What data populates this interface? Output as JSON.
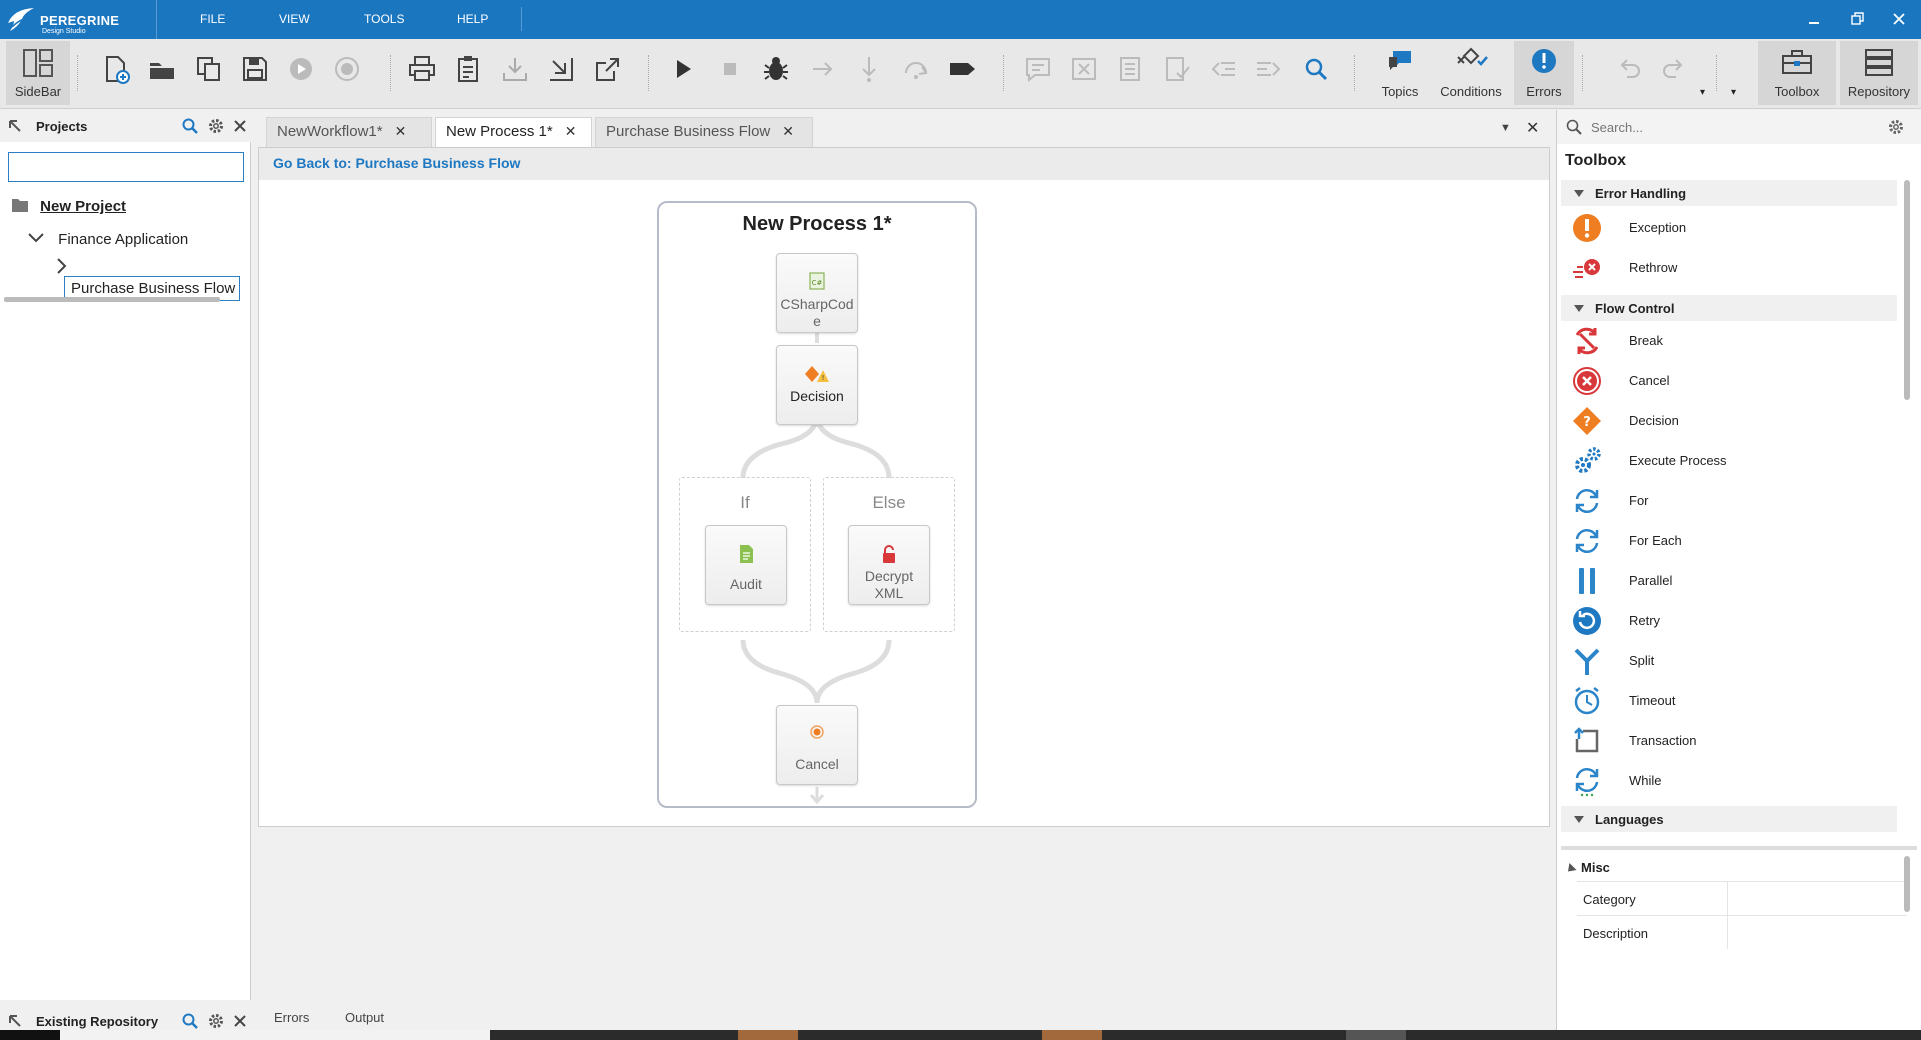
{
  "app": {
    "brand": "PEREGRINE",
    "brand_sub": "Design Studio"
  },
  "menu": [
    "FILE",
    "VIEW",
    "TOOLS",
    "HELP"
  ],
  "toolbar": {
    "sidebar_label": "SideBar",
    "topics_label": "Topics",
    "conditions_label": "Conditions",
    "errors_label": "Errors",
    "toolbox_label": "Toolbox",
    "repository_label": "Repository"
  },
  "left_panel": {
    "projects_title": "Projects",
    "search_value": "",
    "tree": {
      "project": "New Project",
      "folder": "Finance Application",
      "item": "Purchase Business Flow"
    },
    "repo_title": "Existing Repository"
  },
  "tabs": [
    {
      "label": "NewWorkflow1*",
      "active": false
    },
    {
      "label": "New Process 1*",
      "active": true
    },
    {
      "label": "Purchase Business Flow",
      "active": false
    }
  ],
  "editor": {
    "go_back": "Go Back to: Purchase Business Flow",
    "process_title": "New Process 1*",
    "activities": {
      "csharp": "CSharpCode",
      "decision": "Decision",
      "if_label": "If",
      "else_label": "Else",
      "audit": "Audit",
      "decrypt": "Decrypt XML",
      "cancel": "Cancel"
    }
  },
  "bottom_tabs": [
    "Errors",
    "Output"
  ],
  "toolbox": {
    "search_placeholder": "Search...",
    "title": "Toolbox",
    "categories": [
      {
        "name": "Error Handling",
        "items": [
          "Exception",
          "Rethrow"
        ]
      },
      {
        "name": "Flow Control",
        "items": [
          "Break",
          "Cancel",
          "Decision",
          "Execute Process",
          "For",
          "For Each",
          "Parallel",
          "Retry",
          "Split",
          "Timeout",
          "Transaction",
          "While"
        ]
      },
      {
        "name": "Languages",
        "items": []
      }
    ]
  },
  "properties": {
    "group": "Misc",
    "rows": [
      "Category",
      "Description"
    ]
  },
  "colors": {
    "titlebar": "#1b76c0",
    "accent": "#1e78c2",
    "error_orange": "#ef7d22",
    "cancel_red": "#d9383a"
  }
}
